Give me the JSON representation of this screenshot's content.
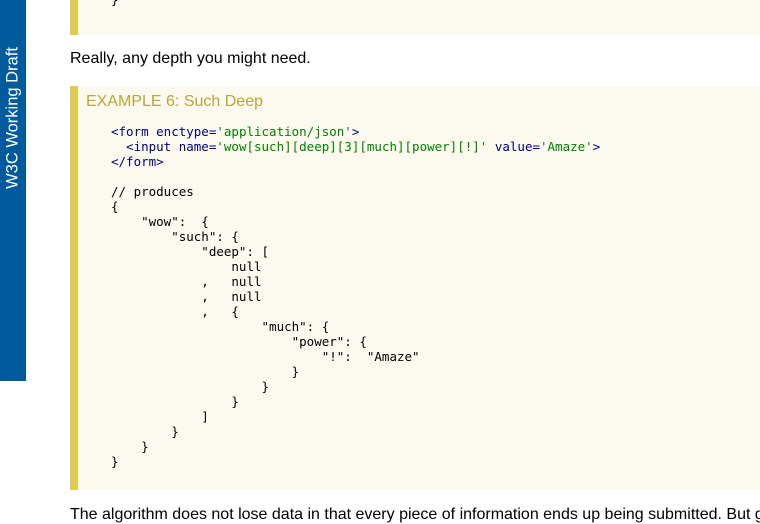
{
  "status_tab": {
    "label": "W3C Working Draft"
  },
  "previous_example": {
    "code_tail": "}"
  },
  "paragraph_1": "Really, any depth you might need.",
  "example": {
    "title": "EXAMPLE 6: Such Deep",
    "html_code": {
      "line1": {
        "open": "<form ",
        "attr": "enctype=",
        "value": "'application/json'",
        "close": ">"
      },
      "line2": {
        "open": "  <input ",
        "attr1": "name=",
        "value1": "'wow[such][deep][3][much][power][!]'",
        "attr2": " value=",
        "value2": "'Amaze'",
        "close": ">"
      },
      "line3": "</form>"
    },
    "json_output": "// produces\n{\n    \"wow\":  {\n        \"such\": {\n            \"deep\": [\n                null\n            ,   null\n            ,   null\n            ,   {\n                    \"much\": {\n                        \"power\": {\n                            \"!\":  \"Amaze\"\n                        }\n                    }\n                }\n            ]\n        }\n    }\n}"
  },
  "paragraph_2": "The algorithm does not lose data in that every piece of information ends up being submitted. But g"
}
